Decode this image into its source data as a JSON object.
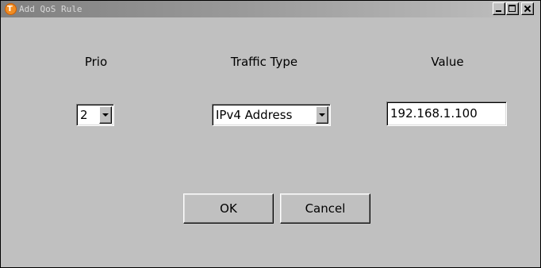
{
  "window": {
    "title": "Add QoS Rule",
    "app_icon": "app-logo-icon",
    "app_icon_letter": "T",
    "controls": [
      "minimize-icon",
      "maximize-icon",
      "close-icon"
    ]
  },
  "form": {
    "prio_label": "Prio",
    "traffic_type_label": "Traffic Type",
    "value_label": "Value",
    "prio_selected": "2",
    "traffic_type_selected": "IPv4 Address",
    "value_text": "192.168.1.100"
  },
  "buttons": {
    "ok_label": "OK",
    "cancel_label": "Cancel"
  },
  "colors": {
    "dialog_background": "#c0c0c0",
    "title_bar_gradient_start": "#808080",
    "title_bar_gradient_end": "#c0c0c0",
    "app_icon": "#f08c22"
  }
}
